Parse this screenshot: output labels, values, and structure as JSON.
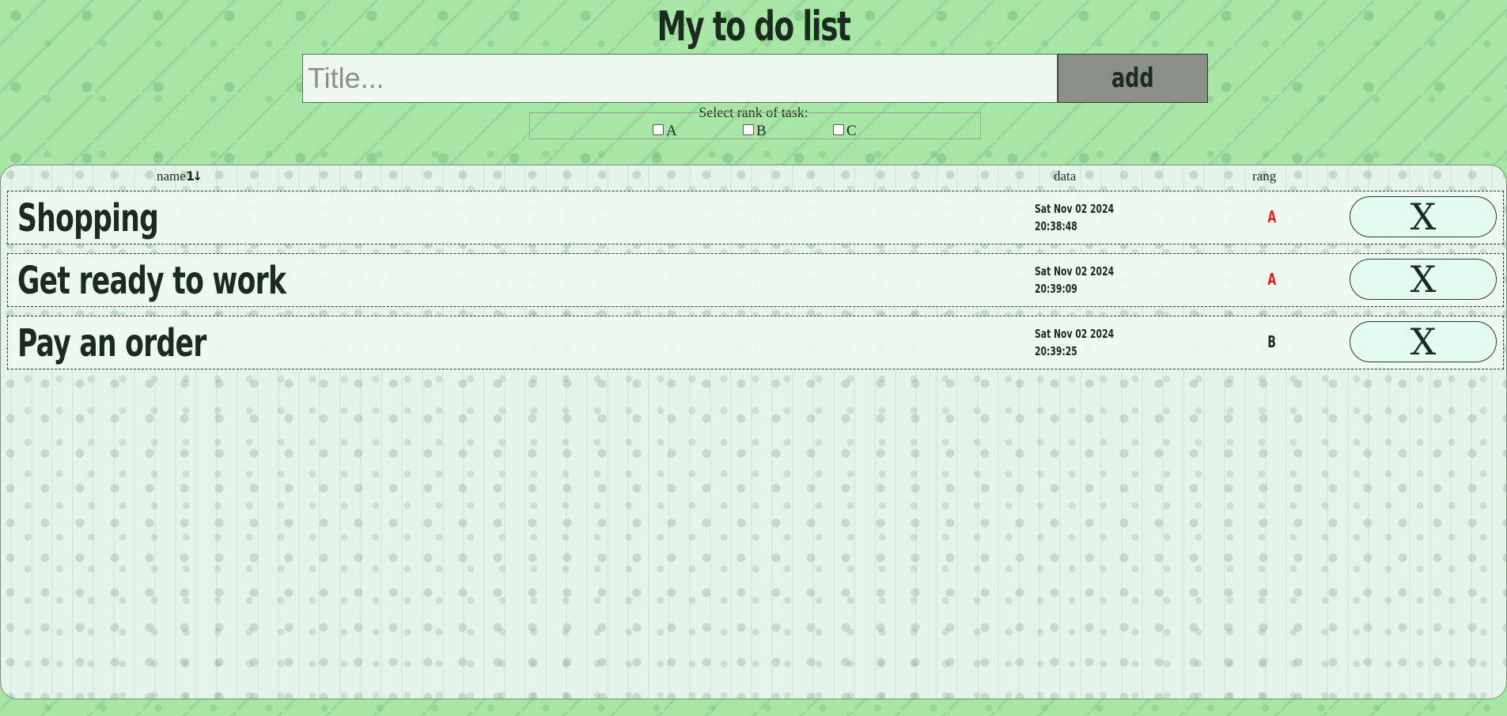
{
  "header": {
    "title": "My to do list"
  },
  "form": {
    "title_placeholder": "Title...",
    "title_value": "",
    "add_label": "add",
    "rank_prompt": "Select rank of task:",
    "rank_options": [
      "A",
      "B",
      "C"
    ]
  },
  "table": {
    "columns": {
      "name": "name",
      "date": "data",
      "rank": "rang"
    },
    "sort_icon": "sort-toggle-icon",
    "delete_label": "X",
    "rows": [
      {
        "name": "Shopping",
        "date_line1": "Sat Nov 02 2024",
        "date_line2": "20:38:48",
        "rank": "A"
      },
      {
        "name": "Get ready to work",
        "date_line1": "Sat Nov 02 2024",
        "date_line2": "20:39:09",
        "rank": "A"
      },
      {
        "name": "Pay an order",
        "date_line1": "Sat Nov 02 2024",
        "date_line2": "20:39:25",
        "rank": "B"
      }
    ]
  },
  "colors": {
    "page_background": "#a8e6a6",
    "panel_background": "#e4f4e8",
    "rank_a": "#e0221b",
    "rank_b": "#1c2b1f",
    "add_button": "#8a9088",
    "delete_button": "#e3fbf1"
  }
}
